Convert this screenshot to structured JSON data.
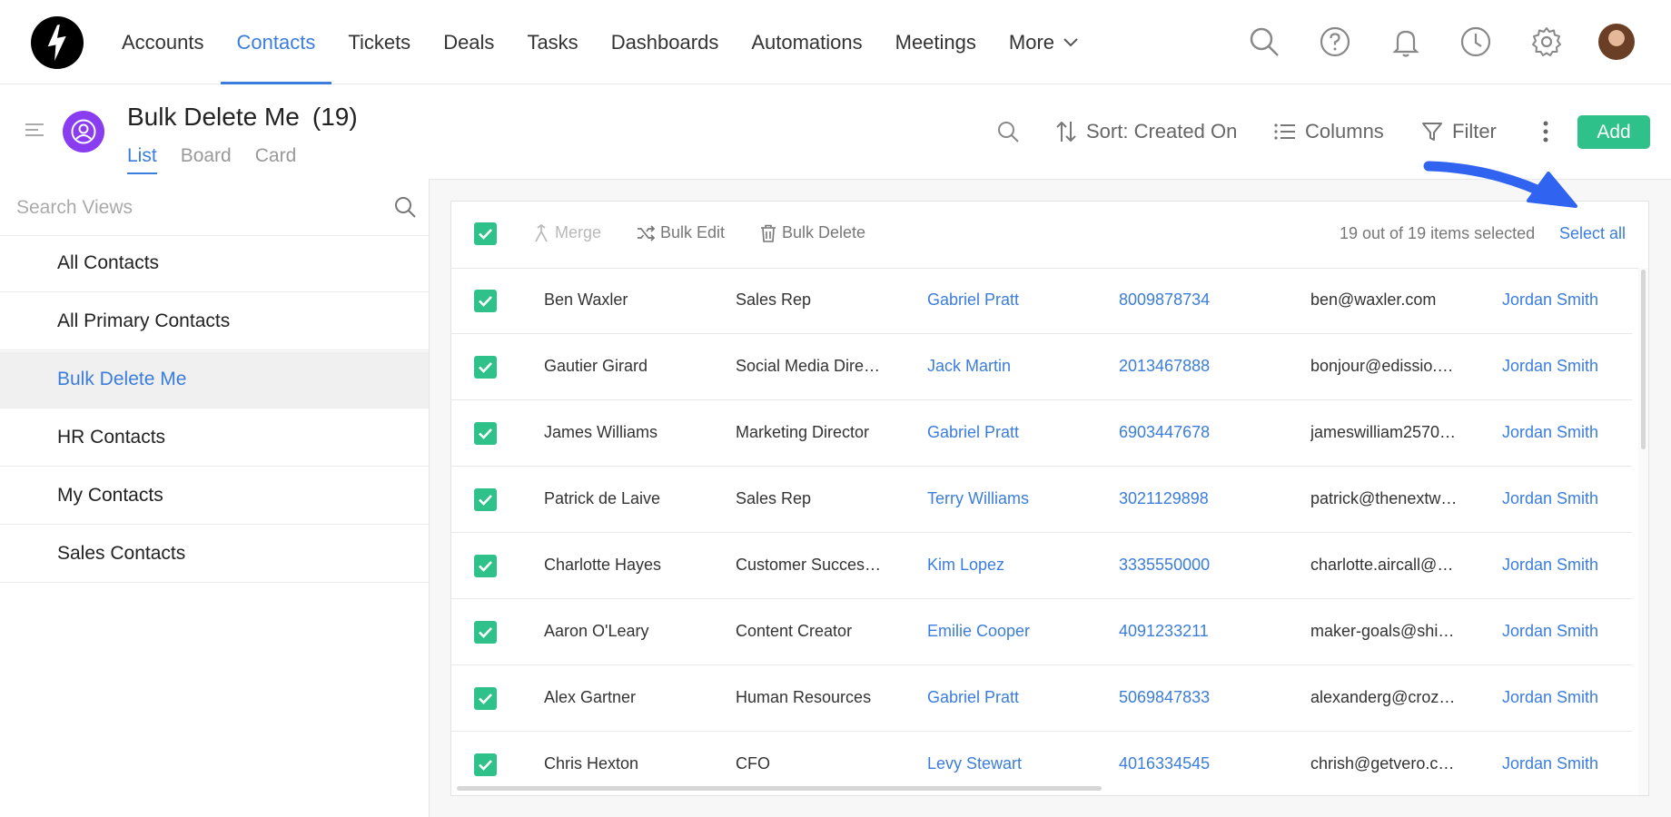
{
  "nav": {
    "items": [
      "Accounts",
      "Contacts",
      "Tickets",
      "Deals",
      "Tasks",
      "Dashboards",
      "Automations",
      "Meetings",
      "More"
    ],
    "active": "Contacts"
  },
  "header": {
    "view_name": "Bulk Delete Me",
    "count": "(19)",
    "tabs": [
      "List",
      "Board",
      "Card"
    ],
    "sort_label": "Sort: Created On",
    "columns_label": "Columns",
    "filter_label": "Filter",
    "add_label": "Add"
  },
  "sidebar": {
    "search_placeholder": "Search Views",
    "items": [
      "All Contacts",
      "All Primary Contacts",
      "Bulk Delete Me",
      "HR Contacts",
      "My Contacts",
      "Sales Contacts"
    ],
    "active": "Bulk Delete Me"
  },
  "bulk": {
    "merge": "Merge",
    "bulk_edit": "Bulk Edit",
    "bulk_delete": "Bulk Delete",
    "selected_text": "19 out of 19 items selected",
    "select_all": "Select all"
  },
  "rows": [
    {
      "name": "Ben Waxler",
      "title": "Sales Rep",
      "owner": "Gabriel Pratt",
      "phone": "8009878734",
      "email": "ben@waxler.com",
      "assignee": "Jordan Smith"
    },
    {
      "name": "Gautier Girard",
      "title": "Social Media Dire…",
      "owner": "Jack Martin",
      "phone": "2013467888",
      "email": "bonjour@edissio.…",
      "assignee": "Jordan Smith"
    },
    {
      "name": "James Williams",
      "title": "Marketing Director",
      "owner": "Gabriel Pratt",
      "phone": "6903447678",
      "email": "jameswilliam2570…",
      "assignee": "Jordan Smith"
    },
    {
      "name": "Patrick de Laive",
      "title": "Sales Rep",
      "owner": "Terry Williams",
      "phone": "3021129898",
      "email": "patrick@thenextw…",
      "assignee": "Jordan Smith"
    },
    {
      "name": "Charlotte Hayes",
      "title": "Customer Succes…",
      "owner": "Kim Lopez",
      "phone": "3335550000",
      "email": "charlotte.aircall@…",
      "assignee": "Jordan Smith"
    },
    {
      "name": "Aaron O'Leary",
      "title": "Content Creator",
      "owner": "Emilie Cooper",
      "phone": "4091233211",
      "email": "maker-goals@shi…",
      "assignee": "Jordan Smith"
    },
    {
      "name": "Alex Gartner",
      "title": "Human Resources",
      "owner": "Gabriel Pratt",
      "phone": "5069847833",
      "email": "alexanderg@croz…",
      "assignee": "Jordan Smith"
    },
    {
      "name": "Chris Hexton",
      "title": "CFO",
      "owner": "Levy Stewart",
      "phone": "4016334545",
      "email": "chrish@getvero.c…",
      "assignee": "Jordan Smith"
    }
  ],
  "colors": {
    "accent": "#3b7ddd",
    "success": "#2ec18a",
    "view_avatar": "#8a3cf0",
    "annotation_arrow": "#2f63f0"
  },
  "icons": [
    "logo-icon",
    "search-icon",
    "help-icon",
    "bell-icon",
    "clock-icon",
    "gear-icon",
    "avatar",
    "hamburger-icon",
    "user-circle-icon",
    "sort-icon",
    "columns-icon",
    "filter-icon",
    "kebab-icon",
    "merge-icon",
    "shuffle-icon",
    "trash-icon",
    "check-icon",
    "annotation-arrow-icon"
  ]
}
